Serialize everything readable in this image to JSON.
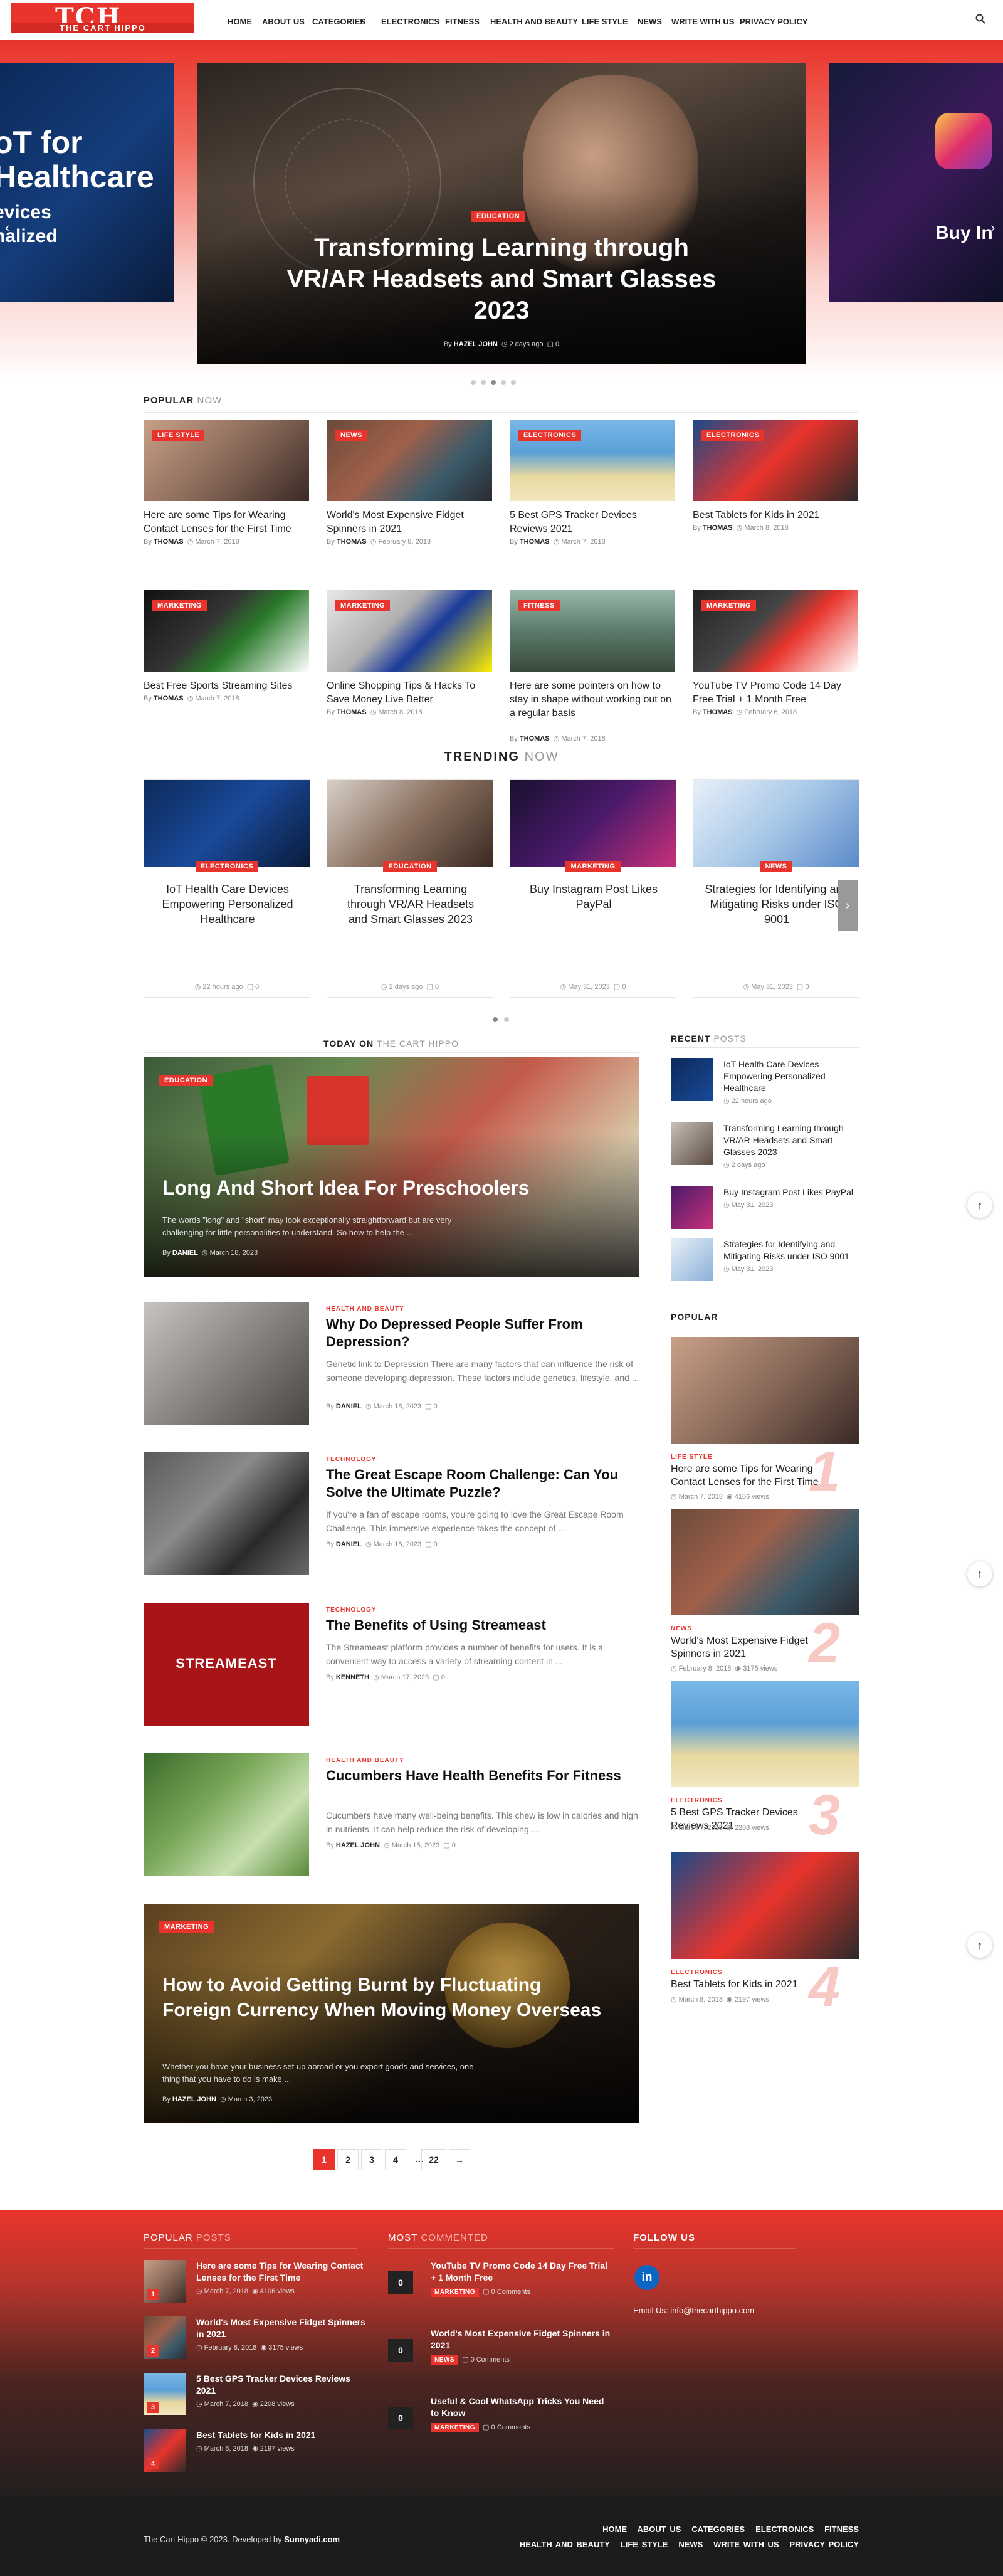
{
  "header": {
    "logo_big": "TCH",
    "logo_small": "THE CART HIPPO",
    "nav": [
      "HOME",
      "ABOUT US",
      "CATEGORIES",
      "ELECTRONICS",
      "FITNESS",
      "HEALTH AND BEAUTY",
      "LIFE STYLE",
      "NEWS",
      "WRITE WITH US",
      "PRIVACY POLICY"
    ]
  },
  "hero": {
    "tag": "EDUCATION",
    "title": "Transforming Learning through VR/AR Headsets and Smart Glasses 2023",
    "by": "By",
    "author": "HAZEL JOHN",
    "time": "2 days ago",
    "comments": "0",
    "left_title": "oT for Healthcare",
    "left_sub": "evices\nnalized",
    "right_text": "Buy In"
  },
  "popular_now": {
    "h1": "POPULAR",
    "h2": "NOW",
    "items": [
      {
        "tag": "LIFE STYLE",
        "title": "Here are some Tips for Wearing Contact Lenses for the First Time",
        "author": "THOMAS",
        "date": "March 7, 2018"
      },
      {
        "tag": "NEWS",
        "title": "World's Most Expensive Fidget Spinners in 2021",
        "author": "THOMAS",
        "date": "February 8, 2018"
      },
      {
        "tag": "ELECTRONICS",
        "title": "5 Best GPS Tracker Devices Reviews 2021",
        "author": "THOMAS",
        "date": "March 7, 2018"
      },
      {
        "tag": "ELECTRONICS",
        "title": "Best Tablets for Kids in 2021",
        "author": "THOMAS",
        "date": "March 8, 2018"
      },
      {
        "tag": "MARKETING",
        "title": "Best Free Sports Streaming Sites",
        "author": "THOMAS",
        "date": "March 7, 2018"
      },
      {
        "tag": "MARKETING",
        "title": "Online Shopping Tips & Hacks To Save Money Live Better",
        "author": "THOMAS",
        "date": "March 8, 2018"
      },
      {
        "tag": "FITNESS",
        "title": "Here are some pointers on how to stay in shape without working out on a regular basis",
        "author": "THOMAS",
        "date": "March 7, 2018"
      },
      {
        "tag": "MARKETING",
        "title": "YouTube TV Promo Code 14 Day Free Trial + 1 Month Free",
        "author": "THOMAS",
        "date": "February 6, 2018"
      }
    ]
  },
  "trending": {
    "h1": "TRENDING",
    "h2": "NOW",
    "items": [
      {
        "tag": "ELECTRONICS",
        "title": "IoT Health Care Devices Empowering Personalized Healthcare",
        "time": "22 hours ago",
        "c": "0"
      },
      {
        "tag": "EDUCATION",
        "title": "Transforming Learning through VR/AR Headsets and Smart Glasses 2023",
        "time": "2 days ago",
        "c": "0"
      },
      {
        "tag": "MARKETING",
        "title": "Buy Instagram Post Likes PayPal",
        "time": "May 31, 2023",
        "c": "0"
      },
      {
        "tag": "NEWS",
        "title": "Strategies for Identifying and Mitigating Risks under ISO 9001",
        "time": "May 31, 2023",
        "c": "0"
      }
    ]
  },
  "today": {
    "h1": "TODAY ON",
    "h2": "THE CART HIPPO",
    "feature": {
      "tag": "EDUCATION",
      "title": "Long And Short Idea For Preschoolers",
      "ex": "The words \"long\" and \"short\" may look exceptionally straightforward but are very challenging for little personalities to understand. So how to help the ...",
      "author": "DANIEL",
      "date": "March 18, 2023"
    },
    "posts": [
      {
        "cat": "HEALTH AND BEAUTY",
        "title": "Why Do Depressed People Suffer From Depression?",
        "ex": "Genetic link to Depression There are many factors that can influence the risk of someone developing depression. These factors include genetics, lifestyle, and ...",
        "author": "DANIEL",
        "date": "March 18, 2023",
        "c": "0"
      },
      {
        "cat": "TECHNOLOGY",
        "title": "The Great Escape Room Challenge: Can You Solve the Ultimate Puzzle?",
        "ex": "If you're a fan of escape rooms, you're going to love the Great Escape Room Challenge. This immersive experience takes the concept of ...",
        "author": "DANIEL",
        "date": "March 18, 2023",
        "c": "0"
      },
      {
        "cat": "TECHNOLOGY",
        "title": "The Benefits of Using Streameast",
        "ex": "The Streameast platform provides a number of benefits for users. It is a convenient way to access a variety of streaming content in ...",
        "author": "KENNETH",
        "date": "March 17, 2023",
        "c": "0"
      },
      {
        "cat": "HEALTH AND BEAUTY",
        "title": "Cucumbers Have Health Benefits For Fitness",
        "ex": "Cucumbers have many well-being benefits. This chew is low in calories and high in nutrients. It can help reduce the risk of developing ...",
        "author": "HAZEL JOHN",
        "date": "March 15, 2023",
        "c": "0"
      }
    ],
    "feature2": {
      "tag": "MARKETING",
      "title": "How to Avoid Getting Burnt by Fluctuating Foreign Currency When Moving Money Overseas",
      "ex": "Whether you have your business set up abroad or you export goods and services, one thing that you have to do is make ...",
      "author": "HAZEL JOHN",
      "date": "March 3, 2023"
    },
    "streameast": "STREAMEAST"
  },
  "pagination": [
    "1",
    "2",
    "3",
    "4",
    "...",
    "22",
    "→"
  ],
  "recent": {
    "h1": "RECENT",
    "h2": "POSTS",
    "items": [
      {
        "title": "IoT Health Care Devices Empowering Personalized Healthcare",
        "time": "22 hours ago"
      },
      {
        "title": "Transforming Learning through VR/AR Headsets and Smart Glasses 2023",
        "time": "2 days ago"
      },
      {
        "title": "Buy Instagram Post Likes PayPal",
        "time": "May 31, 2023"
      },
      {
        "title": "Strategies for Identifying and Mitigating Risks under ISO 9001",
        "time": "May 31, 2023"
      }
    ]
  },
  "popular_side": {
    "h1": "POPULAR",
    "items": [
      {
        "cat": "LIFE STYLE",
        "title": "Here are some Tips for Wearing Contact Lenses for the First Time",
        "date": "March 7, 2018",
        "views": "4106 views",
        "n": "1"
      },
      {
        "cat": "NEWS",
        "title": "World's Most Expensive Fidget Spinners in 2021",
        "date": "February 8, 2018",
        "views": "3175 views",
        "n": "2"
      },
      {
        "cat": "ELECTRONICS",
        "title": "5 Best GPS Tracker Devices Reviews 2021",
        "date": "March 7, 2018",
        "views": "2208 views",
        "n": "3"
      },
      {
        "cat": "ELECTRONICS",
        "title": "Best Tablets for Kids in 2021",
        "date": "March 8, 2018",
        "views": "2197 views",
        "n": "4"
      }
    ]
  },
  "footer": {
    "pop": {
      "h1": "POPULAR",
      "h2": "POSTS",
      "items": [
        {
          "title": "Here are some Tips for Wearing Contact Lenses for the First Time",
          "date": "March 7, 2018",
          "views": "4106 views",
          "n": "1"
        },
        {
          "title": "World's Most Expensive Fidget Spinners in 2021",
          "date": "February 8, 2018",
          "views": "3175 views",
          "n": "2"
        },
        {
          "title": "5 Best GPS Tracker Devices Reviews 2021",
          "date": "March 7, 2018",
          "views": "2208 views",
          "n": "3"
        },
        {
          "title": "Best Tablets for Kids in 2021",
          "date": "March 8, 2018",
          "views": "2197 views",
          "n": "4"
        }
      ]
    },
    "commented": {
      "h1": "MOST",
      "h2": "COMMENTED",
      "items": [
        {
          "title": "YouTube TV Promo Code 14 Day Free Trial + 1 Month Free",
          "tag": "MARKETING",
          "c": "0 Comments",
          "n": "0"
        },
        {
          "title": "World's Most Expensive Fidget Spinners in 2021",
          "tag": "NEWS",
          "c": "0 Comments",
          "n": "0"
        },
        {
          "title": "Useful & Cool WhatsApp Tricks You Need to Know",
          "tag": "MARKETING",
          "c": "0 Comments",
          "n": "0"
        }
      ]
    },
    "follow": {
      "h1": "FOLLOW US",
      "email_label": "Email Us:",
      "email": "info@thecarthippo.com"
    },
    "copyright": "The Cart Hippo © 2023. Developed by",
    "dev": "Sunnyadi.com",
    "nav1": [
      "HOME",
      "ABOUT US",
      "CATEGORIES",
      "ELECTRONICS",
      "FITNESS"
    ],
    "nav2": [
      "HEALTH AND BEAUTY",
      "LIFE STYLE",
      "NEWS",
      "WRITE WITH US",
      "PRIVACY POLICY"
    ]
  }
}
